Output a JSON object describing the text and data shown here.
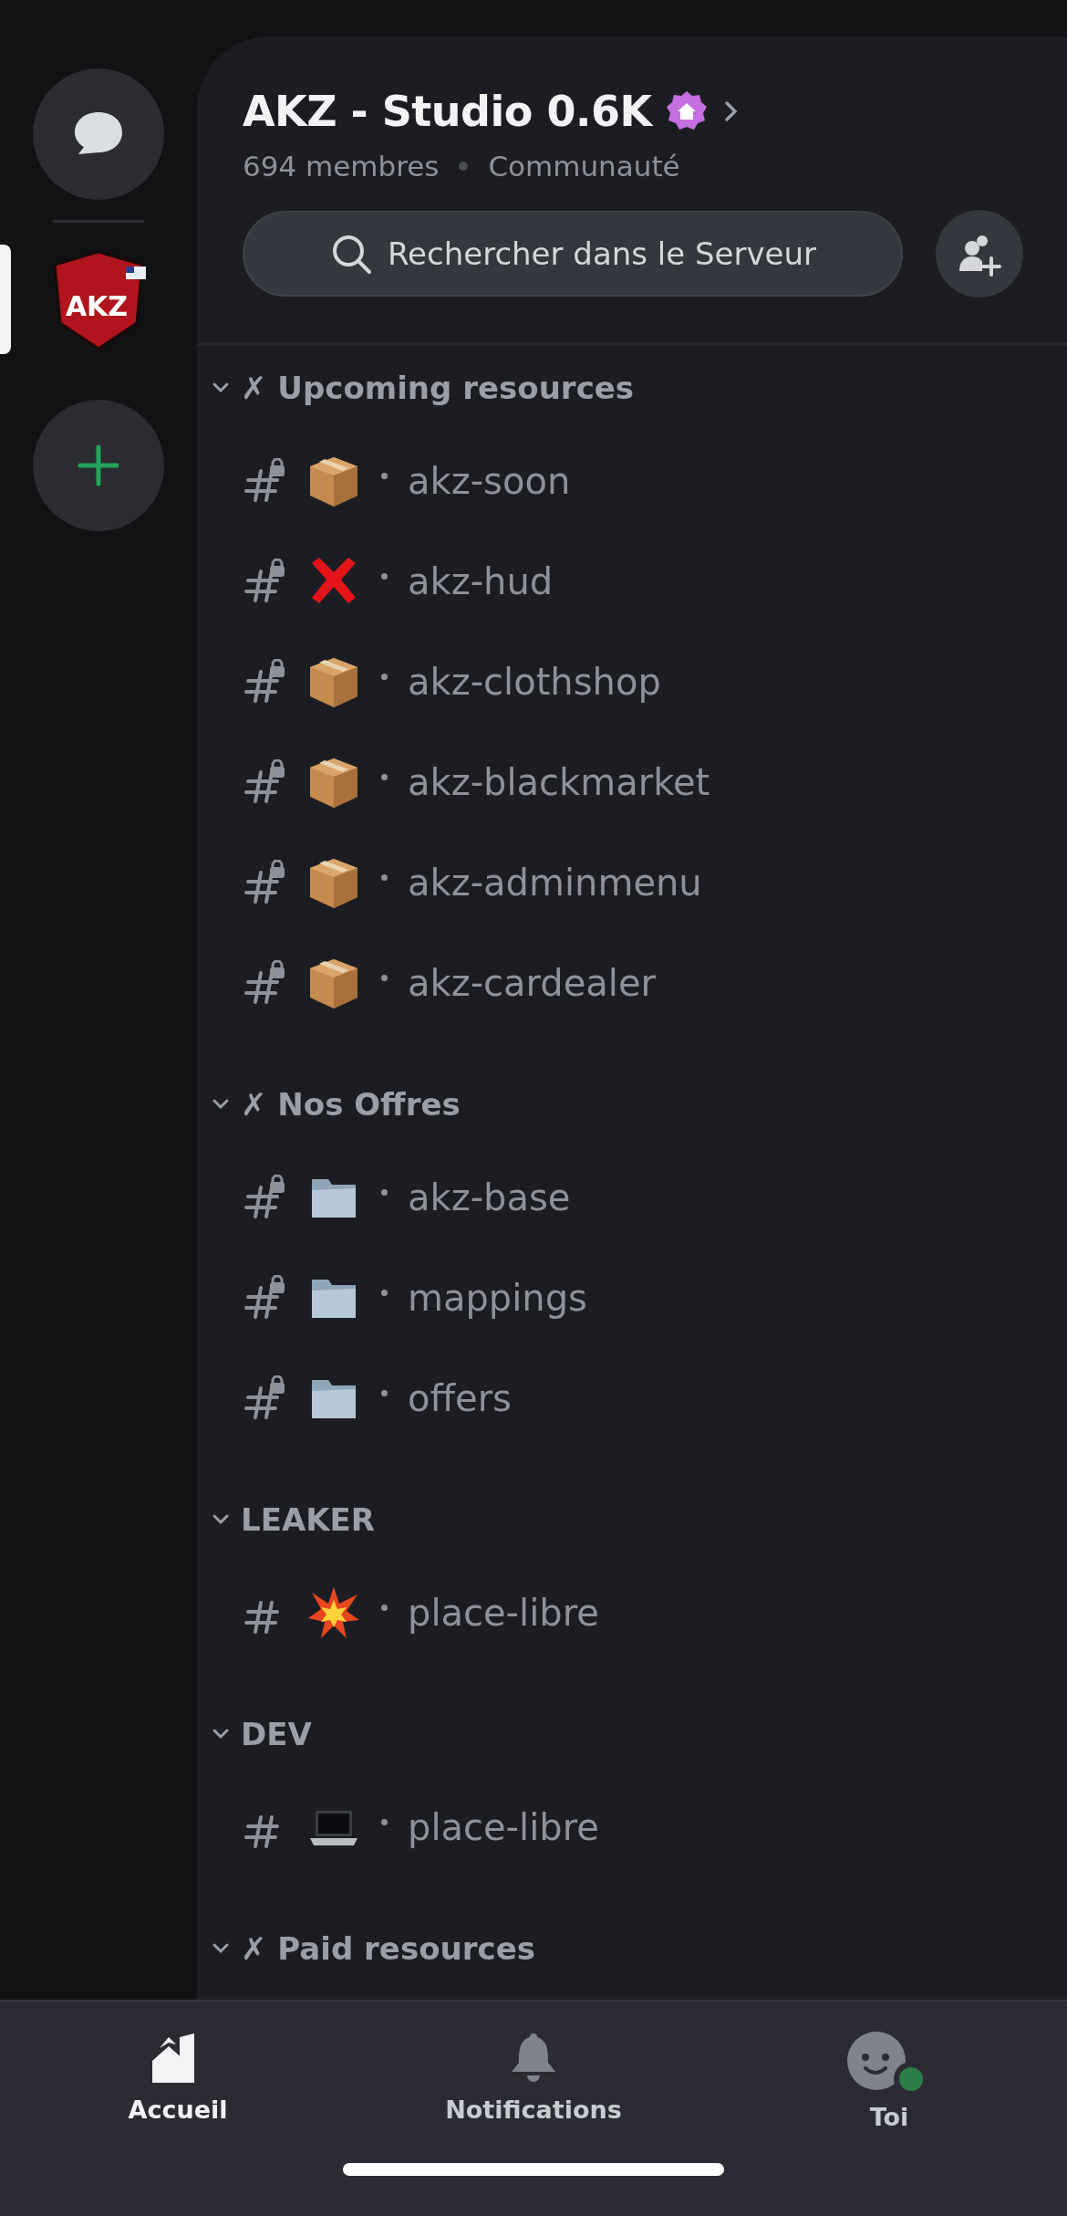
{
  "rail": {
    "dm": {
      "kind": "dm"
    },
    "servers": [
      {
        "logo_text": "AKZ",
        "selected": true
      }
    ],
    "add": {
      "kind": "add"
    }
  },
  "server": {
    "name": "AKZ - Studio 0.6K",
    "community_badge": true,
    "members": "694 membres",
    "type": "Communauté"
  },
  "search": {
    "placeholder": "Rechercher dans le Serveur"
  },
  "categories": [
    {
      "label": "✗ Upcoming resources",
      "expanded": true,
      "channels": [
        {
          "kind": "box",
          "name": "akz-soon",
          "locked": true
        },
        {
          "kind": "cross",
          "name": "akz-hud",
          "locked": true
        },
        {
          "kind": "box",
          "name": "akz-clothshop",
          "locked": true
        },
        {
          "kind": "box",
          "name": "akz-blackmarket",
          "locked": true
        },
        {
          "kind": "box",
          "name": "akz-adminmenu",
          "locked": true
        },
        {
          "kind": "box",
          "name": "akz-cardealer",
          "locked": true
        }
      ]
    },
    {
      "label": "✗ Nos Offres",
      "expanded": true,
      "channels": [
        {
          "kind": "folder",
          "name": "akz-base",
          "locked": true
        },
        {
          "kind": "folder",
          "name": "mappings",
          "locked": true
        },
        {
          "kind": "folder",
          "name": "offers",
          "locked": true
        }
      ]
    },
    {
      "label": "LEAKER",
      "expanded": true,
      "channels": [
        {
          "kind": "collision",
          "name": "place-libre",
          "locked": false
        }
      ]
    },
    {
      "label": "DEV",
      "expanded": true,
      "channels": [
        {
          "kind": "laptop",
          "name": "place-libre",
          "locked": false
        }
      ]
    },
    {
      "label": "✗ Paid resources",
      "expanded": true
    }
  ],
  "nav": [
    {
      "kind": "home",
      "label": "Accueil",
      "selected": true
    },
    {
      "kind": "bell",
      "label": "Notifications",
      "selected": false
    },
    {
      "kind": "avatar",
      "label": "Toi",
      "selected": false,
      "color": "#2d7d46"
    }
  ]
}
